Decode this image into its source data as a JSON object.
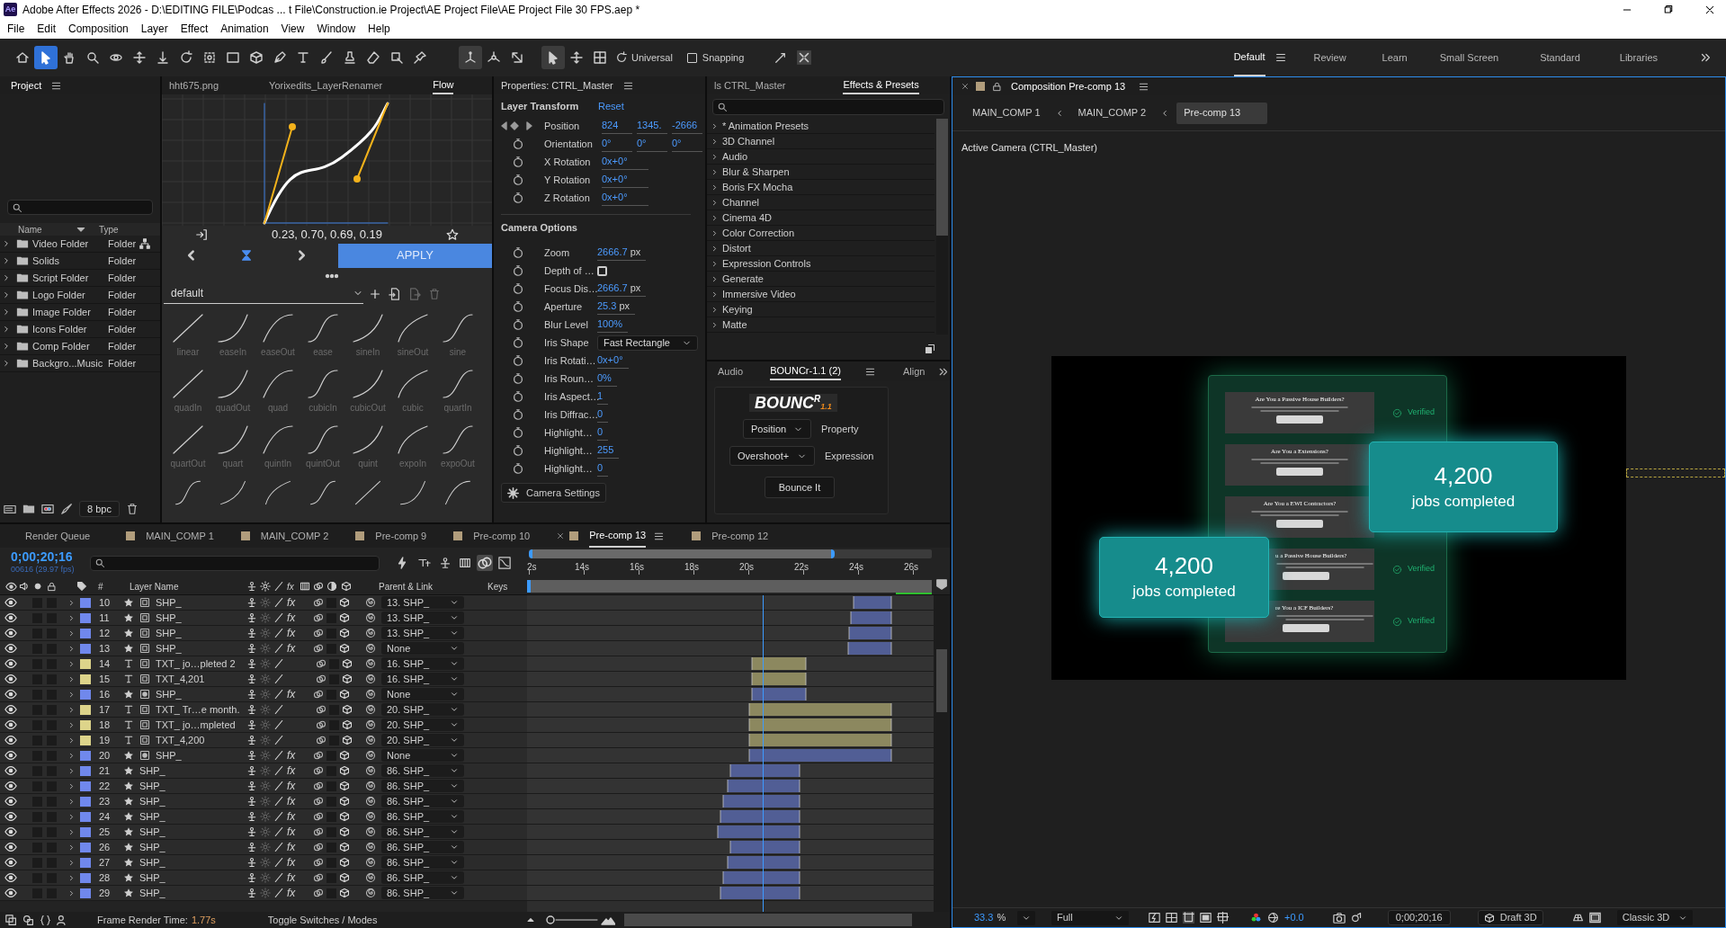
{
  "window": {
    "app_icon": "Ae",
    "title": "Adobe After Effects 2026 - D:\\EDITING FILE\\Podcas ... t File\\Construction.ie Project\\AE Project File\\AE Project File 30 FPS.aep *"
  },
  "menu": [
    "File",
    "Edit",
    "Composition",
    "Layer",
    "Effect",
    "Animation",
    "View",
    "Window",
    "Help"
  ],
  "toolbar": {
    "tools": [
      {
        "kind": "home",
        "selected": false
      },
      {
        "kind": "selection",
        "selected": true
      },
      {
        "kind": "hand",
        "selected": false
      },
      {
        "kind": "zoom",
        "selected": false
      },
      {
        "kind": "orbit",
        "selected": false
      },
      {
        "kind": "move",
        "selected": false
      },
      {
        "kind": "dolly",
        "selected": false
      },
      {
        "kind": "rotate",
        "selected": false
      },
      {
        "kind": "anchor",
        "selected": false
      },
      {
        "kind": "rectangle",
        "selected": false
      },
      {
        "kind": "cube",
        "selected": false
      },
      {
        "kind": "pen",
        "selected": false
      },
      {
        "kind": "type",
        "selected": false
      },
      {
        "kind": "brush",
        "selected": false
      },
      {
        "kind": "stamp",
        "selected": false
      },
      {
        "kind": "eraser",
        "selected": false
      },
      {
        "kind": "roto",
        "selected": false
      },
      {
        "kind": "pin",
        "selected": false
      }
    ],
    "axis_tools": [
      {
        "kind": "local-axis",
        "selected": true
      },
      {
        "kind": "world-axis",
        "selected": false
      },
      {
        "kind": "view-axis",
        "selected": false
      }
    ],
    "gizmo_tools": [
      {
        "kind": "selection",
        "selected": true
      },
      {
        "kind": "move",
        "selected": false
      },
      {
        "kind": "transform-box",
        "selected": false
      }
    ],
    "mode": "Universal",
    "snapping": {
      "label": "Snapping",
      "checked": false
    }
  },
  "workspaces": [
    {
      "label": "Default",
      "selected": true
    },
    {
      "label": "Review",
      "selected": false
    },
    {
      "label": "Learn",
      "selected": false
    },
    {
      "label": "Small Screen",
      "selected": false
    },
    {
      "label": "Standard",
      "selected": false
    },
    {
      "label": "Libraries",
      "selected": false
    }
  ],
  "project": {
    "tab": "Project",
    "columns": [
      "Name",
      "Type"
    ],
    "items": [
      {
        "name": "Video Folder",
        "type": "Folder"
      },
      {
        "name": "Solids",
        "type": "Folder"
      },
      {
        "name": "Script Folder",
        "type": "Folder"
      },
      {
        "name": "Logo Folder",
        "type": "Folder"
      },
      {
        "name": "Image Folder",
        "type": "Folder"
      },
      {
        "name": "Icons Folder",
        "type": "Folder"
      },
      {
        "name": "Comp Folder",
        "type": "Folder"
      },
      {
        "name": "Backgro...Music",
        "type": "Folder"
      }
    ],
    "bpc": "8 bpc"
  },
  "flow": {
    "tabs": [
      {
        "label": "hht675.png",
        "selected": false
      },
      {
        "label": "Yorixedits_LayerRenamer",
        "selected": false
      },
      {
        "label": "Flow",
        "selected": true
      }
    ],
    "values": "0.23, 0.70, 0.69, 0.19",
    "apply": "APPLY",
    "library": "default",
    "presets": [
      "linear",
      "easeIn",
      "easeOut",
      "ease",
      "sineIn",
      "sineOut",
      "sine",
      "quadIn",
      "quadOut",
      "quad",
      "cubicIn",
      "cubicOut",
      "cubic",
      "quartIn",
      "quartOut",
      "quart",
      "quintIn",
      "quintOut",
      "quint",
      "expoIn",
      "expoOut"
    ]
  },
  "properties": {
    "tab": "Properties: CTRL_Master",
    "transform": {
      "heading": "Layer Transform",
      "reset": "Reset",
      "rows": [
        {
          "kind": "keyframe",
          "label": "Position",
          "values": [
            "824",
            "1345.",
            "-2666"
          ]
        },
        {
          "kind": "stopwatch",
          "label": "Orientation",
          "values": [
            "0°",
            "0°",
            "0°"
          ]
        },
        {
          "kind": "stopwatch",
          "label": "X Rotation",
          "values": [
            "0x+0°"
          ]
        },
        {
          "kind": "stopwatch",
          "label": "Y Rotation",
          "values": [
            "0x+0°"
          ]
        },
        {
          "kind": "stopwatch",
          "label": "Z Rotation",
          "values": [
            "0x+0°"
          ]
        }
      ]
    },
    "camera": {
      "heading": "Camera Options",
      "rows": [
        {
          "kind": "value",
          "label": "Zoom",
          "value": "2666.7",
          "unit": "px"
        },
        {
          "kind": "checkbox",
          "label": "Depth of …",
          "checked": false
        },
        {
          "kind": "value",
          "label": "Focus Dis…",
          "value": "2666.7",
          "unit": "px"
        },
        {
          "kind": "value",
          "label": "Aperture",
          "value": "25.3",
          "unit": "px"
        },
        {
          "kind": "value",
          "label": "Blur Level",
          "value": "100%"
        },
        {
          "kind": "dropdown",
          "label": "Iris Shape",
          "value": "Fast Rectangle"
        },
        {
          "kind": "value",
          "label": "Iris Rotati…",
          "value": "0x+0°"
        },
        {
          "kind": "value",
          "label": "Iris Roun…",
          "value": "0%"
        },
        {
          "kind": "value",
          "label": "Iris Aspect…",
          "value": "1"
        },
        {
          "kind": "value",
          "label": "Iris Diffrac…",
          "value": "0"
        },
        {
          "kind": "value",
          "label": "Highlight…",
          "value": "0"
        },
        {
          "kind": "value",
          "label": "Highlight…",
          "value": "255"
        },
        {
          "kind": "value",
          "label": "Highlight…",
          "value": "0"
        }
      ]
    },
    "settings_button": "Camera Settings"
  },
  "effects": {
    "tabs": [
      {
        "label": "ls CTRL_Master",
        "selected": false
      },
      {
        "label": "Effects & Presets",
        "selected": true
      }
    ],
    "categories": [
      "* Animation Presets",
      "3D Channel",
      "Audio",
      "Blur & Sharpen",
      "Boris FX Mocha",
      "Channel",
      "Cinema 4D",
      "Color Correction",
      "Distort",
      "Expression Controls",
      "Generate",
      "Immersive Video",
      "Keying",
      "Matte"
    ]
  },
  "bouncr": {
    "tabs": [
      {
        "label": "Audio",
        "selected": false
      },
      {
        "label": "BOUNCr-1.1 (2)",
        "selected": true
      },
      {
        "label": "Align",
        "selected": false
      }
    ],
    "logo": {
      "text": "BOUNC",
      "mark": "R",
      "version": "1.1"
    },
    "property": {
      "value": "Position",
      "label": "Property"
    },
    "expression": {
      "value": "Overshoot+",
      "label": "Expression"
    },
    "button": "Bounce It"
  },
  "timeline": {
    "tabs": [
      {
        "label": "Render Queue",
        "kind": "queue",
        "selected": false
      },
      {
        "label": "MAIN_COMP 1",
        "kind": "comp",
        "selected": false
      },
      {
        "label": "MAIN_COMP 2",
        "kind": "comp",
        "selected": false
      },
      {
        "label": "Pre-comp 9",
        "kind": "comp",
        "selected": false
      },
      {
        "label": "Pre-comp 10",
        "kind": "comp",
        "selected": false
      },
      {
        "label": "Pre-comp 13",
        "kind": "comp",
        "selected": true
      },
      {
        "label": "Pre-comp 12",
        "kind": "comp",
        "selected": false
      }
    ],
    "timecode": "0;00;20;16",
    "frame_info": "00616 (29.97 fps)",
    "columns": {
      "number": "#",
      "name": "Layer Name",
      "fx": "fx",
      "parent": "Parent & Link",
      "keys": "Keys"
    },
    "ruler": [
      "2s",
      "14s",
      "16s",
      "18s",
      "20s",
      "22s",
      "24s",
      "26s"
    ],
    "playhead": {
      "level": 0.58
    },
    "layers": [
      {
        "number": "10",
        "kind": "shape",
        "color": "#7088ec",
        "source": {
          "kind": "grid"
        },
        "name": "SHP_",
        "fx": "fx",
        "solo": false,
        "locked": false,
        "adjustment": false,
        "parent": "13. SHP_",
        "bar": {
          "in": {
            "level": 0.803
          },
          "out": {
            "level": 0.897
          }
        }
      },
      {
        "number": "11",
        "kind": "shape",
        "color": "#7088ec",
        "source": {
          "kind": "grid"
        },
        "name": "SHP_",
        "fx": "fx",
        "solo": false,
        "locked": false,
        "adjustment": false,
        "parent": "13. SHP_",
        "bar": {
          "in": {
            "level": 0.796
          },
          "out": {
            "level": 0.897
          }
        }
      },
      {
        "number": "12",
        "kind": "shape",
        "color": "#7088ec",
        "source": {
          "kind": "grid"
        },
        "name": "SHP_",
        "fx": "fx",
        "solo": false,
        "locked": false,
        "adjustment": false,
        "parent": "13. SHP_",
        "bar": {
          "in": {
            "level": 0.793
          },
          "out": {
            "level": 0.897
          }
        }
      },
      {
        "number": "13",
        "kind": "shape",
        "color": "#7088ec",
        "source": {
          "kind": "grid"
        },
        "name": "SHP_",
        "fx": "fx",
        "solo": false,
        "locked": false,
        "adjustment": false,
        "parent": "None",
        "bar": {
          "in": {
            "level": 0.789
          },
          "out": {
            "level": 0.897
          }
        }
      },
      {
        "number": "14",
        "kind": "text",
        "color": "#ddd48a",
        "source": {
          "kind": "grid"
        },
        "name": "TXT_ jo…pleted 2",
        "solo": false,
        "locked": false,
        "adjustment": false,
        "parent": "16. SHP_",
        "bar": {
          "in": {
            "level": 0.553
          },
          "out": {
            "level": 0.685
          }
        }
      },
      {
        "number": "15",
        "kind": "text",
        "color": "#ddd48a",
        "source": {
          "kind": "grid"
        },
        "name": "TXT_4,201",
        "solo": false,
        "locked": false,
        "adjustment": false,
        "parent": "16. SHP_",
        "bar": {
          "in": {
            "level": 0.553
          },
          "out": {
            "level": 0.685
          }
        }
      },
      {
        "number": "16",
        "kind": "shape",
        "color": "#7088ec",
        "source": {
          "kind": "dot"
        },
        "name": "SHP_",
        "fx": "fx",
        "solo": false,
        "locked": false,
        "adjustment": false,
        "parent": "None",
        "bar": {
          "in": {
            "level": 0.553
          },
          "out": {
            "level": 0.685
          }
        }
      },
      {
        "number": "17",
        "kind": "text",
        "color": "#ddd48a",
        "source": {
          "kind": "grid"
        },
        "name": "TXT_ Tr…e month.",
        "solo": false,
        "locked": false,
        "adjustment": false,
        "parent": "20. SHP_",
        "bar": {
          "in": {
            "level": 0.547
          },
          "out": {
            "level": 0.897
          }
        }
      },
      {
        "number": "18",
        "kind": "text",
        "color": "#ddd48a",
        "source": {
          "kind": "grid"
        },
        "name": "TXT_ jo…mpleted",
        "solo": false,
        "locked": false,
        "adjustment": false,
        "parent": "20. SHP_",
        "bar": {
          "in": {
            "level": 0.547
          },
          "out": {
            "level": 0.897
          }
        }
      },
      {
        "number": "19",
        "kind": "text",
        "color": "#ddd48a",
        "source": {
          "kind": "grid"
        },
        "name": "TXT_4,200",
        "solo": false,
        "locked": false,
        "adjustment": false,
        "parent": "20. SHP_",
        "bar": {
          "in": {
            "level": 0.547
          },
          "out": {
            "level": 0.897
          }
        }
      },
      {
        "number": "20",
        "kind": "shape",
        "color": "#7088ec",
        "source": {
          "kind": "dot"
        },
        "name": "SHP_",
        "fx": "fx",
        "solo": false,
        "locked": false,
        "adjustment": false,
        "parent": "None",
        "bar": {
          "in": {
            "level": 0.547
          },
          "out": {
            "level": 0.897
          }
        }
      },
      {
        "number": "21",
        "kind": "shape",
        "color": "#7088ec",
        "name": "SHP_",
        "fx": "fx",
        "solo": false,
        "locked": false,
        "adjustment": false,
        "parent": "86. SHP_",
        "bar": {
          "in": {
            "level": 0.499
          },
          "out": {
            "level": 0.671
          }
        }
      },
      {
        "number": "22",
        "kind": "shape",
        "color": "#7088ec",
        "name": "SHP_",
        "fx": "fx",
        "solo": false,
        "locked": false,
        "adjustment": false,
        "parent": "86. SHP_",
        "bar": {
          "in": {
            "level": 0.493
          },
          "out": {
            "level": 0.671
          }
        }
      },
      {
        "number": "23",
        "kind": "shape",
        "color": "#7088ec",
        "name": "SHP_",
        "fx": "fx",
        "solo": false,
        "locked": false,
        "adjustment": false,
        "parent": "86. SHP_",
        "bar": {
          "in": {
            "level": 0.482
          },
          "out": {
            "level": 0.671
          }
        }
      },
      {
        "number": "24",
        "kind": "shape",
        "color": "#7088ec",
        "name": "SHP_",
        "fx": "fx",
        "solo": false,
        "locked": false,
        "adjustment": false,
        "parent": "86. SHP_",
        "bar": {
          "in": {
            "level": 0.476
          },
          "out": {
            "level": 0.671
          }
        }
      },
      {
        "number": "25",
        "kind": "shape",
        "color": "#7088ec",
        "name": "SHP_",
        "fx": "fx",
        "solo": false,
        "locked": false,
        "adjustment": false,
        "parent": "86. SHP_",
        "bar": {
          "in": {
            "level": 0.469
          },
          "out": {
            "level": 0.671
          }
        }
      },
      {
        "number": "26",
        "kind": "shape",
        "color": "#7088ec",
        "name": "SHP_",
        "fx": "fx",
        "solo": false,
        "locked": false,
        "adjustment": false,
        "parent": "86. SHP_",
        "bar": {
          "in": {
            "level": 0.499
          },
          "out": {
            "level": 0.671
          }
        }
      },
      {
        "number": "27",
        "kind": "shape",
        "color": "#7088ec",
        "name": "SHP_",
        "fx": "fx",
        "solo": false,
        "locked": false,
        "adjustment": false,
        "parent": "86. SHP_",
        "bar": {
          "in": {
            "level": 0.493
          },
          "out": {
            "level": 0.671
          }
        }
      },
      {
        "number": "28",
        "kind": "shape",
        "color": "#7088ec",
        "name": "SHP_",
        "fx": "fx",
        "solo": false,
        "locked": false,
        "adjustment": false,
        "parent": "86. SHP_",
        "bar": {
          "in": {
            "level": 0.482
          },
          "out": {
            "level": 0.671
          }
        }
      },
      {
        "number": "29",
        "kind": "shape",
        "color": "#7088ec",
        "name": "SHP_",
        "fx": "fx",
        "solo": false,
        "locked": false,
        "adjustment": false,
        "parent": "86. SHP_",
        "bar": {
          "in": {
            "level": 0.476
          },
          "out": {
            "level": 0.671
          }
        }
      }
    ],
    "status": {
      "render_label": "Frame Render Time:",
      "render_time": "1.77s",
      "toggle": "Toggle Switches / Modes"
    }
  },
  "viewer": {
    "tab": "Composition Pre-comp 13",
    "breadcrumbs": [
      {
        "label": "MAIN_COMP 1",
        "selected": false
      },
      {
        "label": "MAIN_COMP 2",
        "selected": false
      },
      {
        "label": "Pre-comp 13",
        "selected": true
      }
    ],
    "camera": "Active Camera (CTRL_Master)",
    "cards": [
      {
        "title": "Are You a Passive House Builders?",
        "badge": "Verified",
        "covered": false
      },
      {
        "title": "Are You a Extensions?",
        "covered": false
      },
      {
        "title": "Are You a EWI Contractors?",
        "covered": false
      },
      {
        "title": "u a Passive House Builders?",
        "badge": "Verified",
        "covered": true
      },
      {
        "title": "re You a ICF Builders?",
        "badge": "Verified",
        "covered": true
      }
    ],
    "counters": [
      {
        "number": "4,200",
        "label": "jobs completed"
      },
      {
        "number": "4,200",
        "label": "jobs completed"
      }
    ],
    "zoom": "33.3",
    "zoom_unit": "%",
    "resolution": "Full",
    "exposure": "+0.0",
    "timecode": "0;00;20;16",
    "draft": "Draft 3D",
    "renderer": "Classic 3D"
  }
}
